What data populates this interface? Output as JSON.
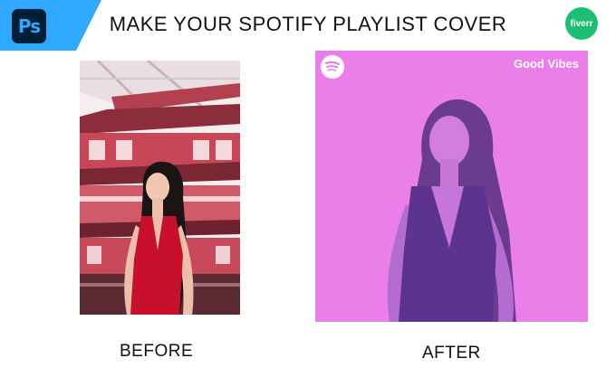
{
  "header": {
    "title": "MAKE YOUR SPOTIFY PLAYLIST COVER",
    "photoshop_badge": "Ps",
    "fiverr_badge": "fiverr"
  },
  "before": {
    "label": "BEFORE"
  },
  "after": {
    "label": "AFTER",
    "cover_title": "Good Vibes"
  },
  "colors": {
    "photoshop_blue": "#31a8ff",
    "photoshop_dark": "#001e36",
    "fiverr_green": "#1dbf73",
    "cover_pink": "#ea7fea",
    "dress_red": "#c8102e"
  },
  "icons": [
    "photoshop-logo-icon",
    "fiverr-logo-icon",
    "spotify-icon"
  ]
}
